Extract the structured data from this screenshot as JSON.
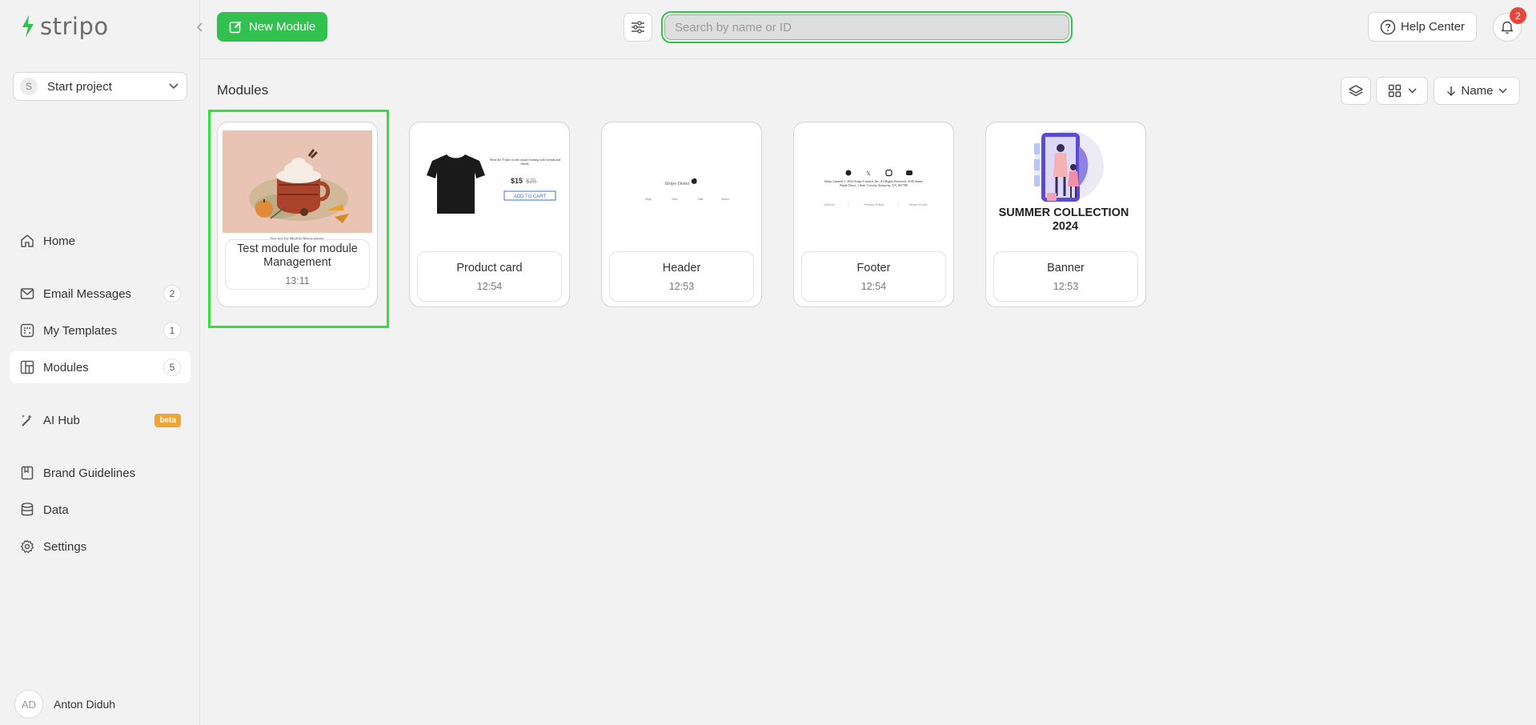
{
  "brand": {
    "logo_text": "stripo",
    "accent": "#32c04f"
  },
  "sidebar": {
    "project": {
      "initial": "S",
      "name": "Start project"
    },
    "nav": {
      "home": {
        "label": "Home",
        "icon": "home-icon"
      },
      "email_messages": {
        "label": "Email Messages",
        "count": "2",
        "icon": "mail-icon"
      },
      "my_templates": {
        "label": "My Templates",
        "count": "1",
        "icon": "templates-icon"
      },
      "modules": {
        "label": "Modules",
        "count": "5",
        "icon": "modules-icon"
      },
      "ai_hub": {
        "label": "AI Hub",
        "badge": "beta",
        "icon": "magic-wand-icon"
      },
      "brand_guidelines": {
        "label": "Brand Guidelines",
        "icon": "book-icon"
      },
      "data": {
        "label": "Data",
        "icon": "database-icon"
      },
      "settings": {
        "label": "Settings",
        "icon": "gear-icon"
      }
    },
    "user": {
      "initials": "AD",
      "name": "Anton Diduh"
    }
  },
  "topbar": {
    "new_module_label": "New Module",
    "search_placeholder": "Search by name or ID",
    "search_value": "",
    "help_label": "Help Center",
    "notifications_count": "2"
  },
  "main": {
    "title": "Modules",
    "sort_label": "Name",
    "modules": [
      {
        "name": "Test module for module Management",
        "time": "13:11",
        "preview_caption": "Test text for Module Management"
      },
      {
        "name": "Product card",
        "time": "12:54",
        "preview_price": "$15",
        "preview_old_price": "$25",
        "preview_cta": "ADD TO CART",
        "preview_text": "Wear the T-shirt on the casual evening with friends and family."
      },
      {
        "name": "Header",
        "time": "12:53",
        "preview_logo": "Stripo Demo",
        "preview_menu": [
          "Shop",
          "New",
          "Sale",
          "About"
        ]
      },
      {
        "name": "Footer",
        "time": "12:54",
        "preview_text": "Stripo Limited © 2024 Stripo Limited, Inc. All Rights Reserved. 4545 Sunny Pande Drive, 1 Stair Creviny, Kentucky, US, 667788",
        "preview_links": [
          "Visit Us",
          "Privacy Policy",
          "Terms of Use"
        ]
      },
      {
        "name": "Banner",
        "time": "12:53",
        "preview_heading": "SUMMER COLLECTION 2024"
      }
    ]
  }
}
